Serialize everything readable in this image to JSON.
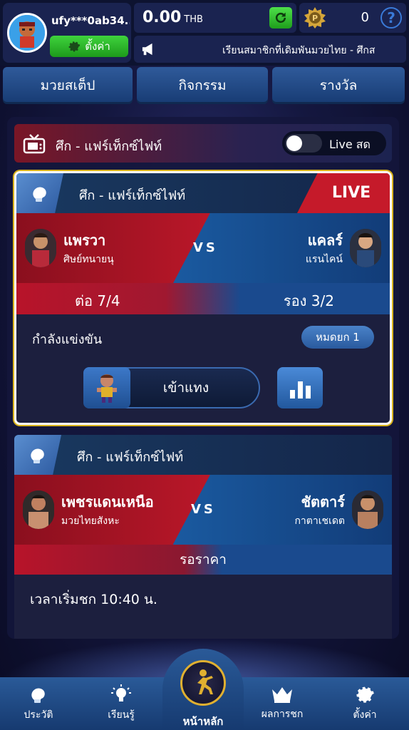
{
  "user": {
    "username": "ufy***0ab34...",
    "settings_label": "ตั้งค่า"
  },
  "wallet": {
    "balance": "0.00",
    "currency": "THB",
    "points": "0",
    "help": "?"
  },
  "marquee": {
    "text": "เรียนสมาชิกที่เดิมพันมวยไทย - ศึกส"
  },
  "top_nav": [
    {
      "label": "มวยสเต็ป"
    },
    {
      "label": "กิจกรรม"
    },
    {
      "label": "รางวัล"
    }
  ],
  "event": {
    "title": "ศึก - แฟร์เท็กซ์ไฟท์",
    "live_toggle_label": "Live สด",
    "live_toggle_on": false
  },
  "matches": [
    {
      "title": "ศึก - แฟร์เท็กซ์ไฟท์",
      "live_badge": "LIVE",
      "red_name": "แพรวา",
      "red_gym": "ศิษย์ทนายนุ",
      "blue_name": "แคลร์",
      "blue_gym": "แรนไคน์",
      "vs": "VS",
      "odds_left": "ต่อ 7/4",
      "odds_right": "รอง 3/2",
      "status": "กำลังแข่งขัน",
      "round": "หมดยก 1",
      "bet_label": "เข้าแทง"
    },
    {
      "title": "ศึก - แฟร์เท็กซ์ไฟท์",
      "red_name": "เพชรแดนเหนือ",
      "red_gym": "มวยไทยสังหะ",
      "blue_name": "ชัตตาร์",
      "blue_gym": "กาตาเชเดต",
      "vs": "VS",
      "wait_label": "รอราคา",
      "start_time": "เวลาเริ่มชก  10:40 น."
    }
  ],
  "bottom_nav": [
    {
      "label": "ประวัติ",
      "icon": "glove-icon"
    },
    {
      "label": "เรียนรู้",
      "icon": "lightbulb-icon"
    },
    {
      "label": "หน้าหลัก",
      "icon": "fighter-logo-icon"
    },
    {
      "label": "ผลการชก",
      "icon": "crown-icon"
    },
    {
      "label": "ตั้งค่า",
      "icon": "gear-icon"
    }
  ],
  "colors": {
    "red_corner": "#c0182a",
    "blue_corner": "#1a5aa0",
    "live_badge": "#c51a2a",
    "accent_green": "#3fd33d",
    "card_border_gold": "#d8b21a"
  }
}
